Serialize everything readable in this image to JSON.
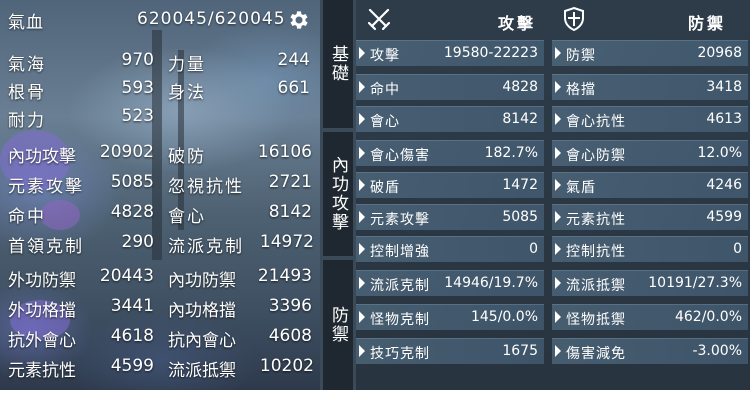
{
  "header": {
    "hp_label": "氣血",
    "hp_value": "620045/620045"
  },
  "left_stats": [
    {
      "label": "氣海",
      "value": "970"
    },
    {
      "label": "力量",
      "value": "244"
    },
    {
      "label": "根骨",
      "value": "593"
    },
    {
      "label": "身法",
      "value": "661"
    },
    {
      "label": "耐力",
      "value": "523"
    },
    {
      "label": "內功攻擊",
      "value": "20902"
    },
    {
      "label": "破防",
      "value": "16106"
    },
    {
      "label": "元素攻擊",
      "value": "5085"
    },
    {
      "label": "忽視抗性",
      "value": "2721"
    },
    {
      "label": "命中",
      "value": "4828"
    },
    {
      "label": "會心",
      "value": "8142"
    },
    {
      "label": "首領克制",
      "value": "290"
    },
    {
      "label": "流派克制",
      "value": "14972"
    },
    {
      "label": "外功防禦",
      "value": "20443"
    },
    {
      "label": "內功防禦",
      "value": "21493"
    },
    {
      "label": "外功格擋",
      "value": "3441"
    },
    {
      "label": "內功格擋",
      "value": "3396"
    },
    {
      "label": "抗外會心",
      "value": "4618"
    },
    {
      "label": "抗內會心",
      "value": "4608"
    },
    {
      "label": "元素抗性",
      "value": "4599"
    },
    {
      "label": "流派抵禦",
      "value": "10202"
    }
  ],
  "tabs": [
    {
      "label": "基礎"
    },
    {
      "label": "內功攻擊"
    },
    {
      "label": "防禦"
    }
  ],
  "attack": {
    "title": "攻擊",
    "rows": [
      {
        "label": "攻擊",
        "value": "19580-22223"
      },
      {
        "label": "命中",
        "value": "4828"
      },
      {
        "label": "會心",
        "value": "8142"
      },
      {
        "label": "會心傷害",
        "value": "182.7%"
      },
      {
        "label": "破盾",
        "value": "1472"
      },
      {
        "label": "元素攻擊",
        "value": "5085"
      },
      {
        "label": "控制增強",
        "value": "0"
      },
      {
        "label": "流派克制",
        "value": "14946/19.7%"
      },
      {
        "label": "怪物克制",
        "value": "145/0.0%"
      },
      {
        "label": "技巧克制",
        "value": "1675"
      }
    ]
  },
  "defense": {
    "title": "防禦",
    "rows": [
      {
        "label": "防禦",
        "value": "20968"
      },
      {
        "label": "格擋",
        "value": "3418"
      },
      {
        "label": "會心抗性",
        "value": "4613"
      },
      {
        "label": "會心防禦",
        "value": "12.0%"
      },
      {
        "label": "氣盾",
        "value": "4246"
      },
      {
        "label": "元素抗性",
        "value": "4599"
      },
      {
        "label": "控制抗性",
        "value": "0"
      },
      {
        "label": "流派抵禦",
        "value": "10191/27.3%"
      },
      {
        "label": "怪物抵禦",
        "value": "462/0.0%"
      },
      {
        "label": "傷害減免",
        "value": "-3.00%"
      }
    ]
  },
  "icons": {
    "settings": "gear-icon",
    "attack": "crossed-swords-icon",
    "defense": "shield-icon"
  },
  "colors": {
    "text": "#ffffff",
    "row_bg": "#5f7d96",
    "panel_bg": "#2e3c4a"
  }
}
